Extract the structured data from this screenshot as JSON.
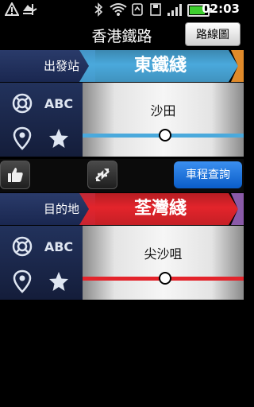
{
  "status_bar": {
    "time": "02:03",
    "icons": [
      "warning-icon",
      "eject-icon",
      "usb-icon",
      "bluetooth-icon",
      "wifi-icon",
      "sync-icon",
      "save-icon",
      "signal-icon",
      "battery-icon"
    ]
  },
  "header": {
    "title": "香港鐵路",
    "map_button": "路線圖"
  },
  "origin": {
    "label": "出發站",
    "line_name": "東鐵綫",
    "line_color": "#4aa9dc",
    "next_line_color": "#e08a2a",
    "abc_label": "ABC",
    "station": "沙田"
  },
  "controls": {
    "query_button": "車程查詢"
  },
  "destination": {
    "label": "目的地",
    "line_name": "荃灣綫",
    "line_color": "#e3242b",
    "next_line_color": "#8a5aa8",
    "abc_label": "ABC",
    "station": "尖沙咀"
  }
}
